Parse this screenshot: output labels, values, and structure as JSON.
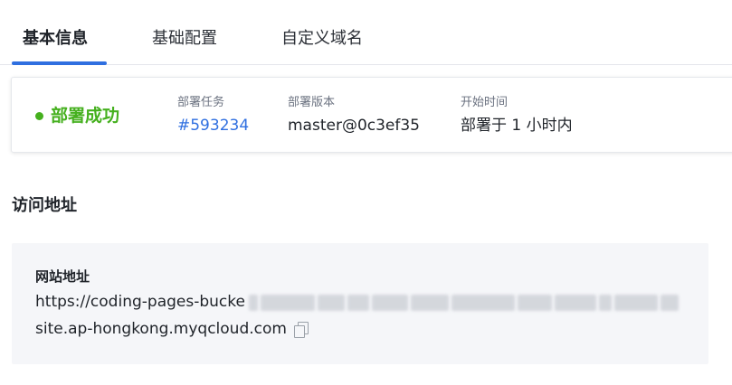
{
  "tabs": [
    {
      "label": "基本信息",
      "active": true
    },
    {
      "label": "基础配置",
      "active": false
    },
    {
      "label": "自定义域名",
      "active": false
    }
  ],
  "deploy": {
    "status": "部署成功",
    "status_color": "#45b01e",
    "task_label": "部署任务",
    "task_value": "#593234",
    "version_label": "部署版本",
    "version_value": "master@0c3ef35",
    "time_label": "开始时间",
    "time_value": "部署于 1 小时内"
  },
  "access": {
    "section_title": "访问地址",
    "site_label": "网站地址",
    "url_prefix": "https://coding-pages-bucke",
    "url_suffix": "site.ap-hongkong.myqcloud.com",
    "copy_icon": "copy-icon"
  },
  "colors": {
    "accent": "#2f6fe0",
    "success": "#45b01e"
  }
}
